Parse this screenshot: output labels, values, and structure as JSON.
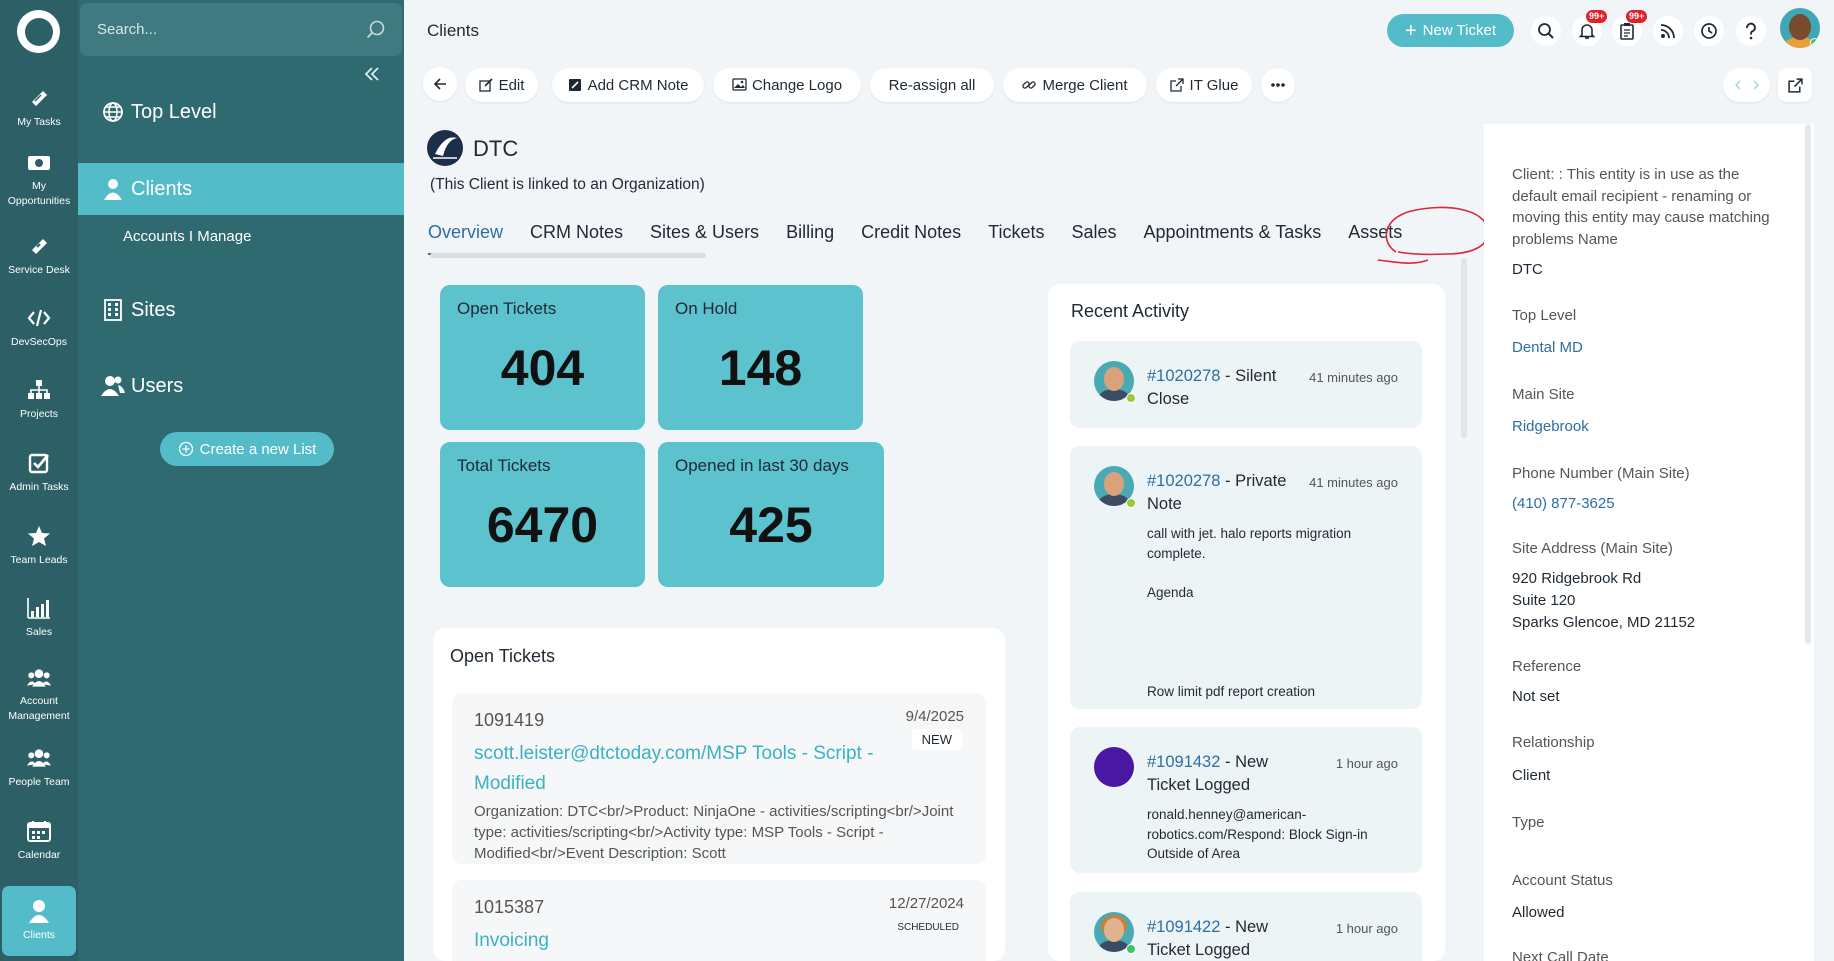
{
  "rail": {
    "items": [
      {
        "label": "My Tasks",
        "icon": "tasks-icon"
      },
      {
        "label": "My Opportunities",
        "icon": "money-icon"
      },
      {
        "label": "Service Desk",
        "icon": "ticket-icon"
      },
      {
        "label": "DevSecOps",
        "icon": "code-icon"
      },
      {
        "label": "Projects",
        "icon": "hierarchy-icon"
      },
      {
        "label": "Admin Tasks",
        "icon": "checkbox-icon"
      },
      {
        "label": "Team Leads",
        "icon": "star-icon"
      },
      {
        "label": "Sales",
        "icon": "chart-icon"
      },
      {
        "label": "Account Management",
        "icon": "group-icon"
      },
      {
        "label": "People Team",
        "icon": "people-icon"
      },
      {
        "label": "Calendar",
        "icon": "calendar-icon"
      },
      {
        "label": "Clients",
        "icon": "user-icon"
      }
    ]
  },
  "sidebar": {
    "search_placeholder": "Search...",
    "top_level": "Top Level",
    "clients": "Clients",
    "accounts_manage": "Accounts I Manage",
    "sites": "Sites",
    "users": "Users",
    "create_list": "Create a new List"
  },
  "header": {
    "title": "Clients",
    "new_ticket": "New Ticket",
    "notification_badge": "99+",
    "tasks_badge": "99+"
  },
  "toolbar": {
    "edit": "Edit",
    "add_crm_note": "Add CRM Note",
    "change_logo": "Change Logo",
    "reassign_all": "Re-assign all",
    "merge_client": "Merge Client",
    "it_glue": "IT Glue"
  },
  "client": {
    "name": "DTC",
    "linked_note": "(This Client is linked to an Organization)"
  },
  "tabs": [
    "Overview",
    "CRM Notes",
    "Sites & Users",
    "Billing",
    "Credit Notes",
    "Tickets",
    "Sales",
    "Appointments & Tasks",
    "Assets"
  ],
  "stats": {
    "open_tickets": {
      "label": "Open Tickets",
      "value": "404"
    },
    "on_hold": {
      "label": "On Hold",
      "value": "148"
    },
    "total_tickets": {
      "label": "Total Tickets",
      "value": "6470"
    },
    "opened_30": {
      "label": "Opened in last 30 days",
      "value": "425"
    }
  },
  "open_tickets": {
    "heading": "Open Tickets",
    "items": [
      {
        "id": "1091419",
        "date": "9/4/2025",
        "status": "NEW",
        "subject": "scott.leister@dtctoday.com/MSP Tools - Script - Modified",
        "desc": "Organization: DTC<br/>Product: NinjaOne - activities/scripting<br/>Joint type: activities/scripting<br/>Activity type: MSP Tools - Script - Modified<br/>Event Description: Scott"
      },
      {
        "id": "1015387",
        "date": "12/27/2024",
        "status": "SCHEDULED",
        "subject": "Invoicing",
        "desc": ""
      }
    ]
  },
  "recent_activity": {
    "heading": "Recent Activity",
    "items": [
      {
        "ticket": "#1020278",
        "title": " - Silent Close",
        "time": "41 minutes ago",
        "body": ""
      },
      {
        "ticket": "#1020278",
        "title": " - Private Note",
        "time": "41 minutes ago",
        "body1": "call with jet. halo reports migration complete.",
        "body2": "Agenda",
        "body3": "Row limit pdf report creation"
      },
      {
        "ticket": "#1091432",
        "title": " - New Ticket Logged",
        "time": "1 hour ago",
        "body": "ronald.henney@american-robotics.com/Respond: Block Sign-in Outside of Area"
      },
      {
        "ticket": "#1091422",
        "title": " - New Ticket Logged",
        "time": "1 hour ago",
        "body": ""
      }
    ]
  },
  "info": {
    "note": "Client: : This entity is in use as the default email recipient - renaming or moving this entity may cause matching problems Name",
    "name_value": "DTC",
    "top_level_label": "Top Level",
    "top_level_value": "Dental MD",
    "main_site_label": "Main Site",
    "main_site_value": "Ridgebrook",
    "phone_label": "Phone Number (Main Site)",
    "phone_value": "(410) 877-3625",
    "address_label": "Site Address (Main Site)",
    "address_line1": "920 Ridgebrook Rd",
    "address_line2": "Suite 120",
    "address_line3": "Sparks Glencoe, MD 21152",
    "reference_label": "Reference",
    "reference_value": "Not set",
    "relationship_label": "Relationship",
    "relationship_value": "Client",
    "type_label": "Type",
    "account_status_label": "Account Status",
    "account_status_value": "Allowed",
    "next_call_label": "Next Call Date"
  },
  "colors": {
    "rail": "#2c6066",
    "sidebar": "#2e6a70",
    "accent": "#54bcc9",
    "tile": "#5bc2ce",
    "link": "#2d6ea3",
    "annotation": "#d9283a"
  }
}
